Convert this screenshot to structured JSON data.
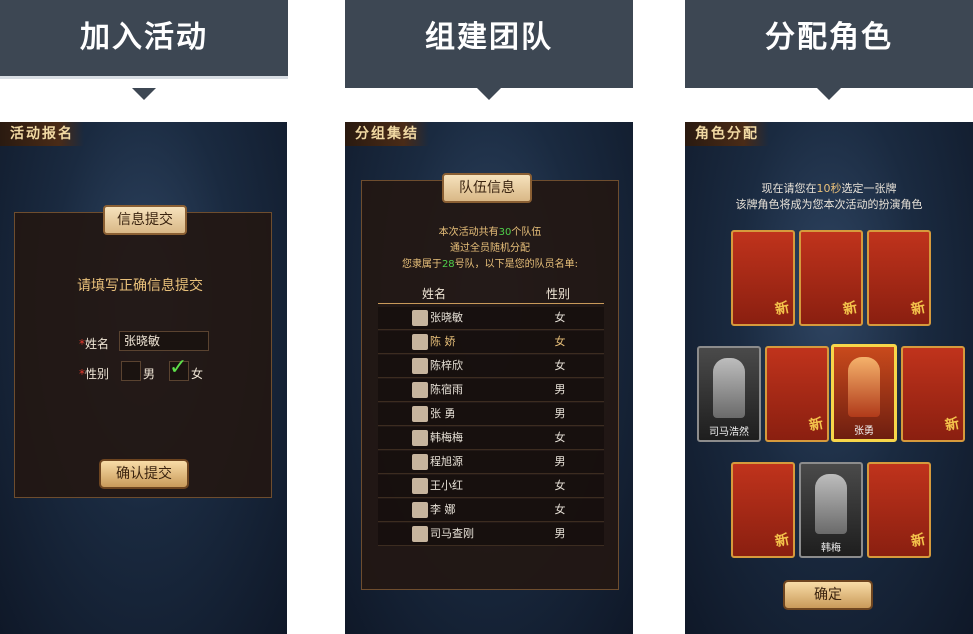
{
  "panels": [
    {
      "header": "加入活动",
      "screen_title": "活动报名",
      "plaque": "信息提交",
      "prompt": "请填写正确信息提交",
      "name_label": "姓名",
      "name_value": "张晓敏",
      "gender_label": "性别",
      "male_label": "男",
      "female_label": "女",
      "submit": "确认提交"
    },
    {
      "header": "组建团队",
      "screen_title": "分组集结",
      "plaque": "队伍信息",
      "info": {
        "l1a": "本次活动共有",
        "l1n": "30",
        "l1b": "个队伍",
        "l2": "通过全员随机分配",
        "l3a": "您隶属于",
        "l3n": "28",
        "l3b": "号队，以下是您的队员名单:"
      },
      "col_name": "姓名",
      "col_gender": "性别",
      "members": [
        {
          "name": "张晓敏",
          "gender": "女"
        },
        {
          "name": "陈  娇",
          "gender": "女"
        },
        {
          "name": "陈梓欣",
          "gender": "女"
        },
        {
          "name": "陈宿雨",
          "gender": "男"
        },
        {
          "name": "张  勇",
          "gender": "男"
        },
        {
          "name": "韩梅梅",
          "gender": "女"
        },
        {
          "name": "程旭源",
          "gender": "男"
        },
        {
          "name": "王小红",
          "gender": "女"
        },
        {
          "name": "李  娜",
          "gender": "女"
        },
        {
          "name": "司马查刚",
          "gender": "男"
        }
      ]
    },
    {
      "header": "分配角色",
      "screen_title": "角色分配",
      "line1a": "现在请您在",
      "line1n": "10秒",
      "line1b": "选定一张牌",
      "line2": "该牌角色将成为您本次活动的扮演角色",
      "card_names": [
        "司马浩然",
        "张勇",
        "韩梅"
      ],
      "confirm": "确定"
    }
  ]
}
